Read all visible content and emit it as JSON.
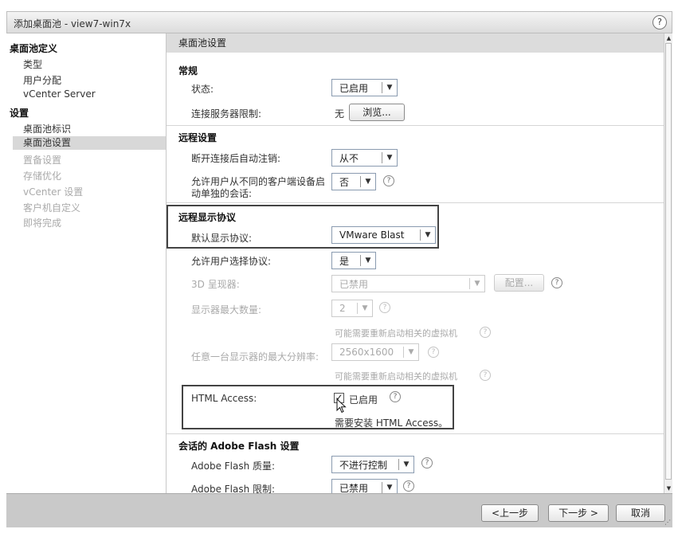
{
  "window": {
    "title": "添加桌面池 - view7-win7x",
    "help": "?"
  },
  "sidebar": {
    "section1": "桌面池定义",
    "items1": [
      "类型",
      "用户分配",
      "vCenter Server"
    ],
    "section2": "设置",
    "items2": [
      "桌面池标识",
      "桌面池设置",
      "置备设置",
      "存储优化",
      "vCenter 设置",
      "客户机自定义",
      "即将完成"
    ],
    "selected": "桌面池设置"
  },
  "panel": {
    "header": "桌面池设置"
  },
  "general": {
    "title": "常规",
    "state_label": "状态:",
    "state_value": "已启用",
    "conn_label": "连接服务器限制:",
    "conn_value": "无",
    "browse": "浏览..."
  },
  "remote": {
    "title": "远程设置",
    "logoff_label": "断开连接后自动注销:",
    "logoff_value": "从不",
    "sep_session_label_1": "允许用户从不同的客户端设备启",
    "sep_session_label_2": "动单独的会话:",
    "sep_session_value": "否"
  },
  "display": {
    "title": "远程显示协议",
    "default_label": "默认显示协议:",
    "default_value": "VMware Blast",
    "allow_label": "允许用户选择协议:",
    "allow_value": "是",
    "renderer_label": "3D 呈现器:",
    "renderer_value": "已禁用",
    "configure": "配置...",
    "max_monitors_label": "显示器最大数量:",
    "max_monitors_value": "2",
    "restart_note": "可能需要重新启动相关的虚拟机",
    "max_res_label": "任意一台显示器的最大分辨率:",
    "max_res_value": "2560x1600",
    "restart_note2": "可能需要重新启动相关的虚拟机",
    "html_label": "HTML Access:",
    "html_checked": true,
    "html_value": "已启用",
    "html_note": "需要安装 HTML Access。"
  },
  "flash": {
    "title": "会话的 Adobe Flash 设置",
    "quality_label": "Adobe Flash 质量:",
    "quality_value": "不进行控制",
    "throttle_label": "Adobe Flash 限制:",
    "throttle_value": "已禁用"
  },
  "footer": {
    "back": "<上一步",
    "next": "下一步 >",
    "cancel": "取消"
  },
  "icons": {
    "help": "?",
    "caret": "▼"
  }
}
